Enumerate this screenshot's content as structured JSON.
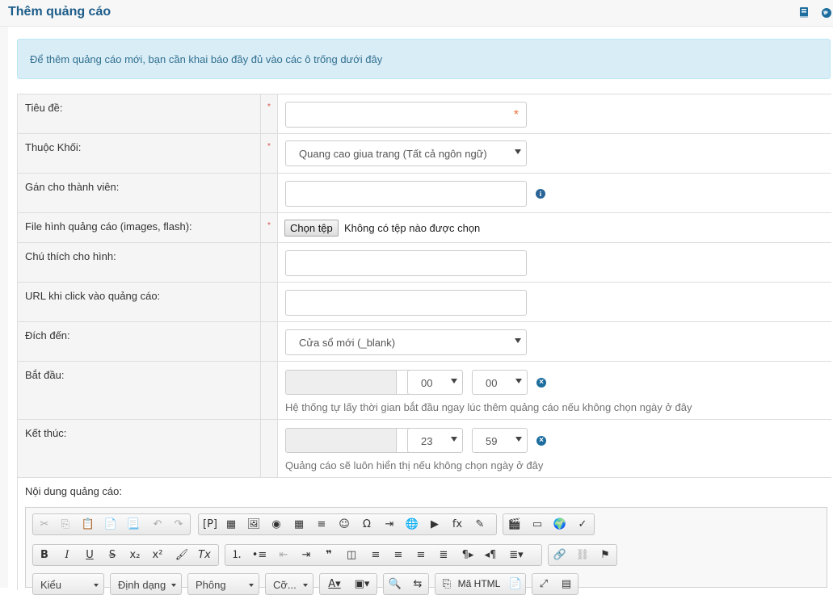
{
  "header": {
    "title": "Thêm quảng cáo",
    "icons": [
      "book-icon",
      "globe-icon"
    ]
  },
  "alert": {
    "text": "Để thêm quảng cáo mới, bạn cần khai báo đầy đủ vào các ô trống dưới đây"
  },
  "form": {
    "title_label": "Tiêu đề:",
    "block_label": "Thuộc Khối:",
    "block_value": "Quang cao giua trang (Tất cả ngôn ngữ)",
    "member_label": "Gán cho thành viên:",
    "file_label": "File hình quảng cáo (images, flash):",
    "file_button": "Chọn tệp",
    "file_status": "Không có tệp nào được chọn",
    "caption_label": "Chú thích cho hình:",
    "url_label": "URL khi click vào quảng cáo:",
    "target_label": "Đích đến:",
    "target_value": "Cửa sổ mới (_blank)",
    "start_label": "Bắt đầu:",
    "start_hour": "00",
    "start_minute": "00",
    "start_help": "Hệ thống tự lấy thời gian bắt đầu ngay lúc thêm quảng cáo nếu không chọn ngày ở đây",
    "end_label": "Kết thúc:",
    "end_hour": "23",
    "end_minute": "59",
    "end_help": "Quảng cáo sẽ luôn hiển thị nếu không chọn ngày ở đây",
    "content_label": "Nội dung quảng cáo:",
    "required_mark": "*"
  },
  "editor": {
    "combo_styles": "Kiểu",
    "combo_format": "Định dạng",
    "combo_font": "Phông",
    "combo_size": "Cỡ...",
    "source_button": "Mã HTML"
  }
}
